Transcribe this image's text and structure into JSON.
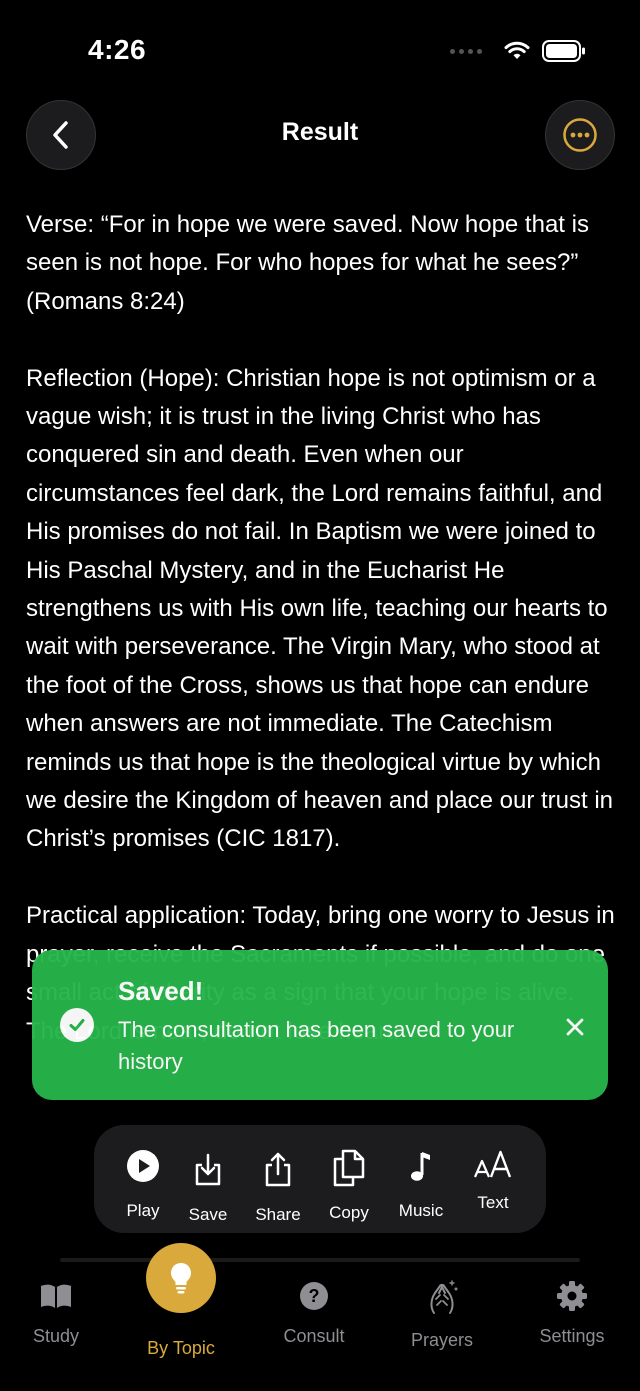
{
  "status": {
    "time": "4:26"
  },
  "header": {
    "title": "Result"
  },
  "content": {
    "verse": "Verse: “For in hope we were saved. Now hope that is seen is not hope. For who hopes for what he sees?” (Romans 8:24)",
    "reflection": "Reflection (Hope): Christian hope is not optimism or a vague wish; it is trust in the living Christ who has conquered sin and death. Even when our circumstances feel dark, the Lord remains faithful, and His promises do not fail. In Baptism we were joined to His Paschal Mystery, and in the Eucharist He strengthens us with His own life, teaching our hearts to wait with perseverance. The Virgin Mary, who stood at the foot of the Cross, shows us that hope can endure when answers are not immediate. The Catechism reminds us that hope is the theological virtue by which we desire the Kingdom of heaven and place our trust in Christ’s promises (CIC 1817).",
    "practical": "Practical application: Today, bring one worry to Jesus in prayer, receive the Sacraments if possible, and do one small act of charity as a sign that your hope is alive. The Lord is near; do not lose heart."
  },
  "toast": {
    "title": "Saved!",
    "message": "The consultation has been saved to your history"
  },
  "actions": [
    {
      "label": "Play",
      "icon": "play-icon"
    },
    {
      "label": "Save",
      "icon": "save-icon"
    },
    {
      "label": "Share",
      "icon": "share-icon"
    },
    {
      "label": "Copy",
      "icon": "copy-icon"
    },
    {
      "label": "Music",
      "icon": "music-icon"
    },
    {
      "label": "Text",
      "icon": "text-size-icon"
    }
  ],
  "tabs": [
    {
      "label": "Study",
      "icon": "book-icon"
    },
    {
      "label": "By Topic",
      "icon": "lightbulb-icon",
      "active": true
    },
    {
      "label": "Consult",
      "icon": "question-icon"
    },
    {
      "label": "Prayers",
      "icon": "praying-hands-icon"
    },
    {
      "label": "Settings",
      "icon": "gear-icon"
    }
  ],
  "colors": {
    "accent": "#d9a93c",
    "toast": "#27b54a",
    "background": "#000000"
  }
}
